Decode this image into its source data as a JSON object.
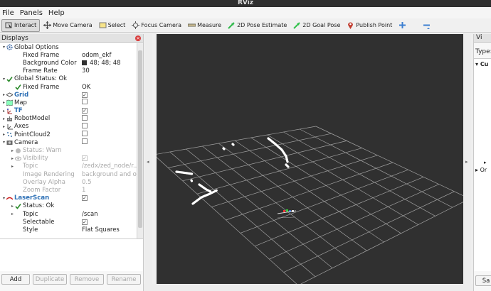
{
  "window": {
    "title": "RViz"
  },
  "menu": [
    "File",
    "Panels",
    "Help"
  ],
  "toolbar": [
    {
      "label": "Interact",
      "icon": "interact-icon",
      "active": true
    },
    {
      "label": "Move Camera",
      "icon": "move-camera-icon"
    },
    {
      "label": "Select",
      "icon": "select-icon"
    },
    {
      "label": "Focus Camera",
      "icon": "focus-camera-icon"
    },
    {
      "label": "Measure",
      "icon": "measure-icon"
    },
    {
      "label": "2D Pose Estimate",
      "icon": "pose-estimate-icon"
    },
    {
      "label": "2D Goal Pose",
      "icon": "goal-pose-icon"
    },
    {
      "label": "Publish Point",
      "icon": "publish-point-icon"
    },
    {
      "label": "",
      "icon": "plus-icon"
    },
    {
      "label": "",
      "icon": "minus-icon"
    }
  ],
  "displays_panel": {
    "title": "Displays",
    "rows": [
      {
        "indent": 0,
        "arrow": "▾",
        "icon": "gear-icon",
        "name": "Global Options",
        "value": ""
      },
      {
        "indent": 1,
        "arrow": "",
        "icon": "",
        "name": "Fixed Frame",
        "value": "odom_ekf"
      },
      {
        "indent": 1,
        "arrow": "",
        "icon": "",
        "name": "Background Color",
        "value": "48; 48; 48",
        "swatch": "#303030"
      },
      {
        "indent": 1,
        "arrow": "",
        "icon": "",
        "name": "Frame Rate",
        "value": "30"
      },
      {
        "indent": 0,
        "arrow": "▾",
        "icon": "check-icon",
        "name": "Global Status: Ok",
        "value": ""
      },
      {
        "indent": 1,
        "arrow": "",
        "icon": "check-icon",
        "name": "Fixed Frame",
        "value": "OK"
      },
      {
        "indent": 0,
        "arrow": "▸",
        "icon": "grid-icon",
        "name": "Grid",
        "value": "",
        "checkbox": true,
        "checked": true,
        "blue": true
      },
      {
        "indent": 0,
        "arrow": "▸",
        "icon": "map-icon",
        "name": "Map",
        "value": "",
        "checkbox": true,
        "checked": false
      },
      {
        "indent": 0,
        "arrow": "▸",
        "icon": "tf-icon",
        "name": "TF",
        "value": "",
        "checkbox": true,
        "checked": true,
        "blue": true
      },
      {
        "indent": 0,
        "arrow": "▸",
        "icon": "robot-model-icon",
        "name": "RobotModel",
        "value": "",
        "checkbox": true,
        "checked": false
      },
      {
        "indent": 0,
        "arrow": "▸",
        "icon": "axes-icon",
        "name": "Axes",
        "value": "",
        "checkbox": true,
        "checked": false
      },
      {
        "indent": 0,
        "arrow": "▸",
        "icon": "pointcloud-icon",
        "name": "PointCloud2",
        "value": "",
        "checkbox": true,
        "checked": false
      },
      {
        "indent": 0,
        "arrow": "▾",
        "icon": "camera-icon",
        "name": "Camera",
        "value": "",
        "checkbox": true,
        "checked": false
      },
      {
        "indent": 1,
        "arrow": "▸",
        "icon": "warn-icon",
        "name": "Status: Warn",
        "value": "",
        "disabled": true
      },
      {
        "indent": 1,
        "arrow": "▸",
        "icon": "eye-icon",
        "name": "Visibility",
        "value": "",
        "checkbox": true,
        "checked": true,
        "disabled": true
      },
      {
        "indent": 1,
        "arrow": "▸",
        "icon": "",
        "name": "Topic",
        "value": "/zedx/zed_node/r...",
        "disabled": true
      },
      {
        "indent": 1,
        "arrow": "",
        "icon": "",
        "name": "Image Rendering",
        "value": "background and o...",
        "disabled": true
      },
      {
        "indent": 1,
        "arrow": "",
        "icon": "",
        "name": "Overlay Alpha",
        "value": "0.5",
        "disabled": true
      },
      {
        "indent": 1,
        "arrow": "",
        "icon": "",
        "name": "Zoom Factor",
        "value": "1",
        "disabled": true
      },
      {
        "indent": 0,
        "arrow": "▾",
        "icon": "laserscan-icon",
        "name": "LaserScan",
        "value": "",
        "checkbox": true,
        "checked": true,
        "blue": true
      },
      {
        "indent": 1,
        "arrow": "▸",
        "icon": "check-icon",
        "name": "Status: Ok",
        "value": ""
      },
      {
        "indent": 1,
        "arrow": "▸",
        "icon": "",
        "name": "Topic",
        "value": "/scan"
      },
      {
        "indent": 1,
        "arrow": "",
        "icon": "",
        "name": "Selectable",
        "value": "",
        "checkbox": true,
        "checked": true
      },
      {
        "indent": 1,
        "arrow": "",
        "icon": "",
        "name": "Style",
        "value": "Flat Squares"
      }
    ]
  },
  "buttons": {
    "add": "Add",
    "duplicate": "Duplicate",
    "remove": "Remove",
    "rename": "Rename"
  },
  "views_panel": {
    "title": "Vi",
    "type_label": "Type:",
    "current": "Cu",
    "orbit": "Or",
    "save": "Sa"
  },
  "colors": {
    "background": "#303030",
    "grid": "#a0a0a0",
    "scan": "#ffffff",
    "accent_blue": "#2c6fb5"
  }
}
